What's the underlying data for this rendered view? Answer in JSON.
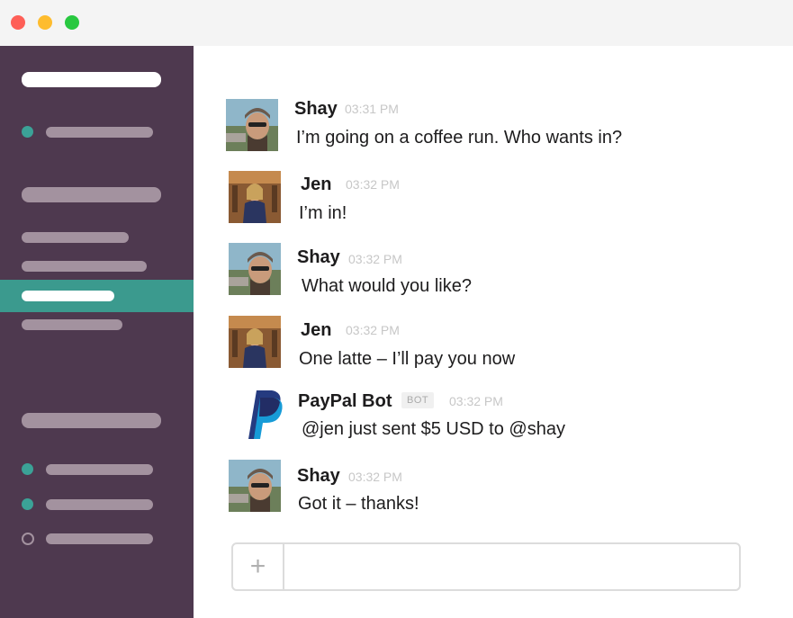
{
  "window": {
    "controls": [
      "close",
      "minimize",
      "zoom"
    ]
  },
  "colors": {
    "sidebar": "#4e394f",
    "active_channel": "#3b9a8e",
    "online_dot": "#3ba297",
    "placeholder_bar": "#a3929f"
  },
  "messages": [
    {
      "author": "Shay",
      "time": "03:31 PM",
      "text": "I’m going on a coffee run. Who wants in?",
      "avatar": "shay-avatar"
    },
    {
      "author": "Jen",
      "time": "03:32 PM",
      "text": "I’m in!",
      "avatar": "jen-avatar"
    },
    {
      "author": "Shay",
      "time": "03:32 PM",
      "text": "What would you like?",
      "avatar": "shay-avatar"
    },
    {
      "author": "Jen",
      "time": "03:32 PM",
      "text": "One latte – I’ll pay you now",
      "avatar": "jen-avatar"
    },
    {
      "author": "PayPal Bot",
      "badge": "BOT",
      "time": "03:32 PM",
      "text": "@jen just sent $5 USD to @shay",
      "avatar": "paypal-logo-icon"
    },
    {
      "author": "Shay",
      "time": "03:32 PM",
      "text": "Got it – thanks!",
      "avatar": "shay-avatar"
    }
  ],
  "composer": {
    "plus_label": "+",
    "placeholder": ""
  }
}
